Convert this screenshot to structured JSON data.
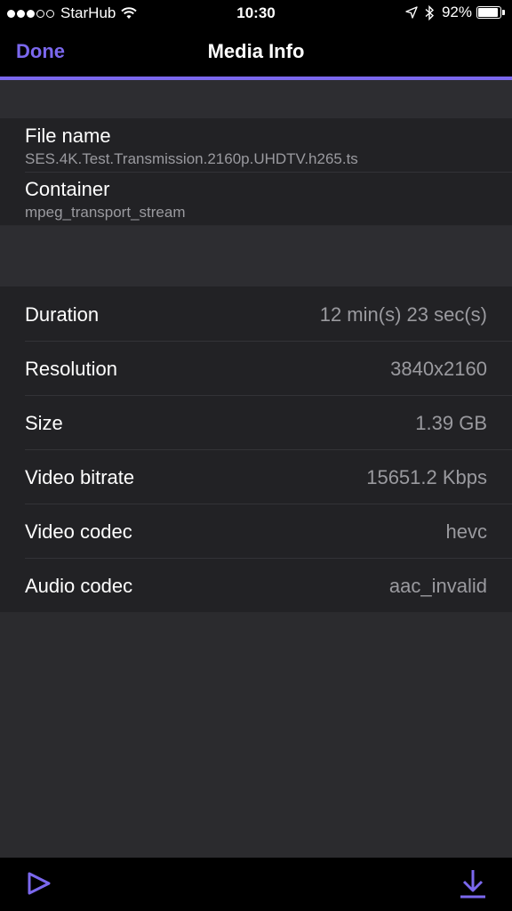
{
  "status_bar": {
    "carrier": "StarHub",
    "time": "10:30",
    "battery_percent": "92%",
    "battery_level": 0.92,
    "signal_bars_filled": 3,
    "signal_bars_total": 5
  },
  "nav": {
    "done_label": "Done",
    "title": "Media Info"
  },
  "file_info": {
    "file_name_label": "File name",
    "file_name_value": "SES.4K.Test.Transmission.2160p.UHDTV.h265.ts",
    "container_label": "Container",
    "container_value": "mpeg_transport_stream"
  },
  "details": [
    {
      "label": "Duration",
      "value": "12 min(s) 23 sec(s)"
    },
    {
      "label": "Resolution",
      "value": "3840x2160"
    },
    {
      "label": "Size",
      "value": "1.39 GB"
    },
    {
      "label": "Video bitrate",
      "value": "15651.2 Kbps"
    },
    {
      "label": "Video codec",
      "value": "hevc"
    },
    {
      "label": "Audio codec",
      "value": "aac_invalid"
    }
  ],
  "toolbar": {
    "play_icon": "play-icon",
    "download_icon": "download-icon"
  },
  "colors": {
    "accent": "#7b68ee",
    "background": "#2b2b2e",
    "row_background": "#222225",
    "secondary_text": "#9a9a9f"
  }
}
